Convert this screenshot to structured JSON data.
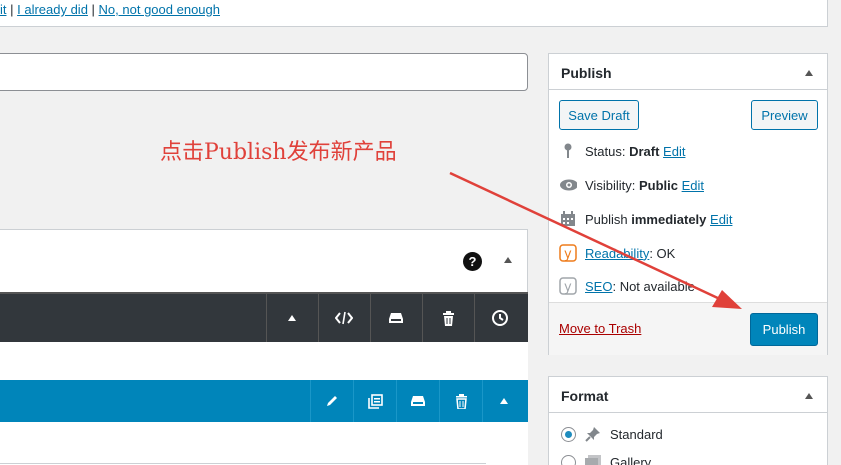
{
  "notice": {
    "link_prefix": "it",
    "sep1": " | ",
    "already_did": "I already did",
    "sep2": " | ",
    "not_good": "No, not good enough"
  },
  "annotation": {
    "text": "点击Publish发布新产品",
    "color": "#e0413a"
  },
  "product_data": {
    "help_icon_char": "?"
  },
  "dark_toolbar": {
    "icons": [
      "arrow-up-icon",
      "code-icon",
      "drawer-icon",
      "trash-icon",
      "history-icon"
    ]
  },
  "blue_toolbar": {
    "icons": [
      "pencil-icon",
      "duplicate-icon",
      "drawer-icon",
      "trash-icon",
      "arrow-up-icon"
    ]
  },
  "publish_box": {
    "title": "Publish",
    "save_draft": "Save Draft",
    "preview": "Preview",
    "status_label": "Status: ",
    "status_value": "Draft",
    "visibility_label": "Visibility: ",
    "visibility_value": "Public",
    "publish_label": "Publish ",
    "publish_value": "immediately",
    "edit": "Edit",
    "readability_link": "Readability",
    "readability_value": ": OK",
    "seo_link": "SEO",
    "seo_value": ": Not available",
    "move_to_trash": "Move to Trash",
    "publish_button": "Publish"
  },
  "format_box": {
    "title": "Format",
    "options": [
      "Standard",
      "Gallery"
    ],
    "selected": "Standard"
  },
  "colors": {
    "accent": "#0085ba",
    "link": "#0073aa",
    "dark_toolbar": "#32373c",
    "trash": "#a00"
  }
}
